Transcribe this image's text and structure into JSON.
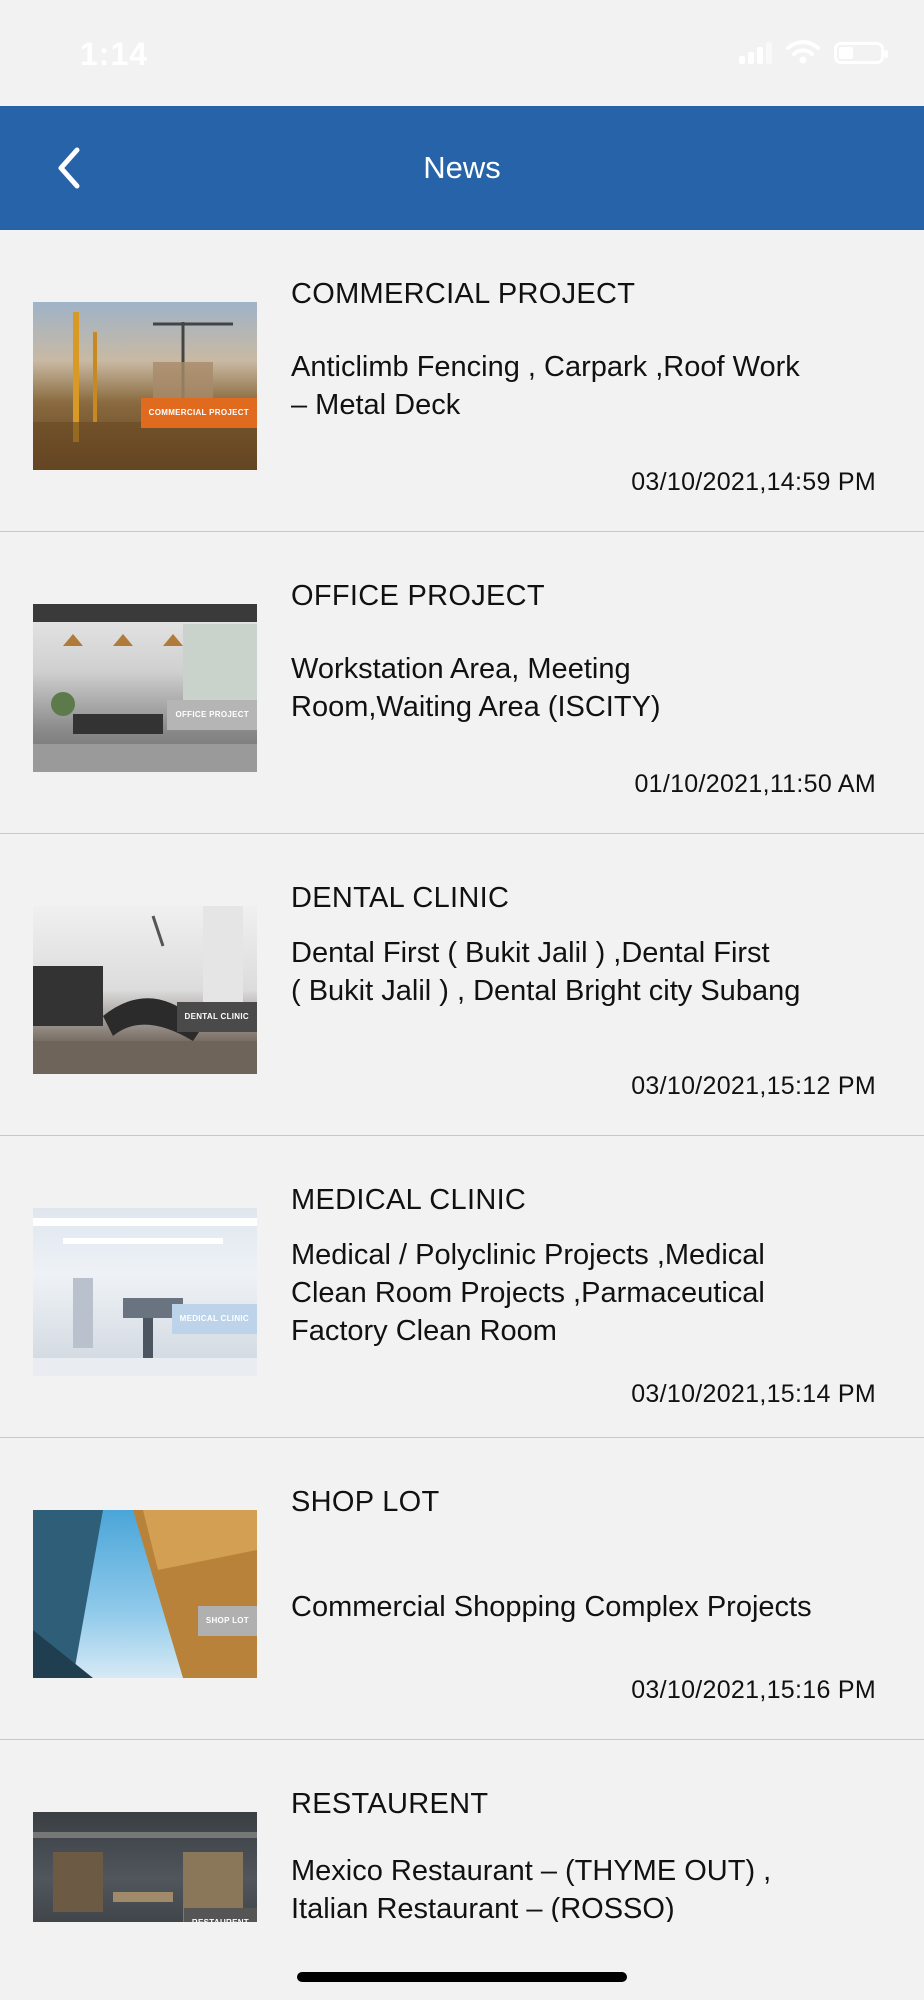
{
  "status_bar": {
    "time": "1:14"
  },
  "nav": {
    "title": "News",
    "back_icon": "chevron-left-icon"
  },
  "news": [
    {
      "title": "COMMERCIAL PROJECT",
      "description": " Anticlimb Fencing , Carpark ,Roof Work\n– Metal Deck",
      "date": "03/10/2021,14:59 PM",
      "thumb_label": "COMMERCIAL PROJECT",
      "accent": "#e06a1e"
    },
    {
      "title": "OFFICE PROJECT",
      "description": " Workstation Area, Meeting\nRoom,Waiting Area (ISCITY)",
      "date": "01/10/2021,11:50 AM",
      "thumb_label": "OFFICE PROJECT",
      "accent": "#a9a9a9"
    },
    {
      "title": "DENTAL CLINIC",
      "description": " Dental First ( Bukit Jalil )  ,Dental First\n( Bukit Jalil ) , Dental Bright city Subang",
      "date": "03/10/2021,15:12 PM",
      "thumb_label": "DENTAL CLINIC",
      "accent": "#4a4a4a"
    },
    {
      "title": "MEDICAL CLINIC",
      "description": " Medical / Polyclinic Projects ,Medical\nClean Room Projects ,Parmaceutical\nFactory Clean Room",
      "date": "03/10/2021,15:14 PM",
      "thumb_label": "MEDICAL CLINIC",
      "accent": "#bcd3ea"
    },
    {
      "title": "SHOP LOT",
      "description": " Commercial Shopping Complex Projects",
      "date": "03/10/2021,15:16 PM",
      "thumb_label": "SHOP LOT",
      "accent": "#b0b0b0"
    },
    {
      "title": "RESTAURENT",
      "description": " Mexico Restaurant – (THYME OUT) ,\nItalian Restaurant – (ROSSO)",
      "date": "",
      "thumb_label": "RESTAURENT",
      "accent": "#555555"
    }
  ]
}
